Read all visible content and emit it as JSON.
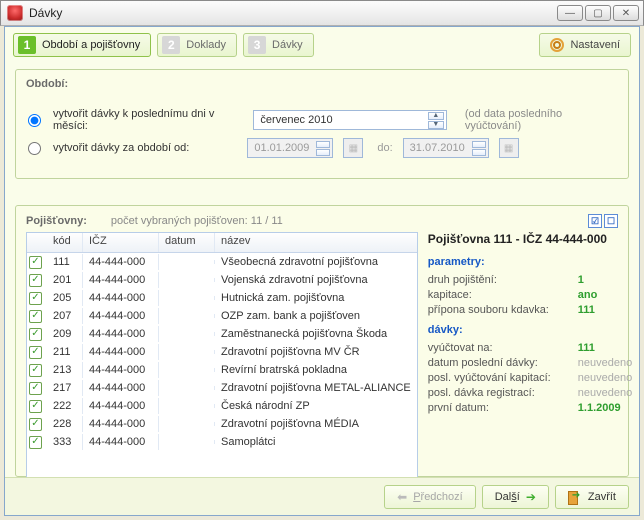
{
  "window": {
    "title": "Dávky"
  },
  "steps": [
    {
      "num": "1",
      "label": "Období a pojišťovny",
      "active": true
    },
    {
      "num": "2",
      "label": "Doklady",
      "active": false
    },
    {
      "num": "3",
      "label": "Dávky",
      "active": false
    }
  ],
  "settings_label": "Nastavení",
  "period": {
    "legend": "Období:",
    "opt_month_label": "vytvořit dávky k poslednímu dni v měsíci:",
    "opt_range_label": "vytvořit dávky za období od:",
    "month_value": "červenec 2010",
    "hint": "(od data posledního vyúčtování)",
    "date_from": "01.01.2009",
    "date_to_label": "do:",
    "date_to": "31.07.2010",
    "selected": "month"
  },
  "insurers": {
    "legend": "Pojišťovny:",
    "count_label": "počet vybraných pojišťoven: 11 / 11",
    "columns": {
      "kod": "kód",
      "icz": "IČZ",
      "datum": "datum",
      "nazev": "název"
    },
    "rows": [
      {
        "checked": true,
        "kod": "111",
        "icz": "44-444-000",
        "datum": "",
        "nazev": "Všeobecná zdravotní pojišťovna"
      },
      {
        "checked": true,
        "kod": "201",
        "icz": "44-444-000",
        "datum": "",
        "nazev": "Vojenská zdravotní pojišťovna"
      },
      {
        "checked": true,
        "kod": "205",
        "icz": "44-444-000",
        "datum": "",
        "nazev": "Hutnická zam. pojišťovna"
      },
      {
        "checked": true,
        "kod": "207",
        "icz": "44-444-000",
        "datum": "",
        "nazev": "OZP zam. bank a pojišťoven"
      },
      {
        "checked": true,
        "kod": "209",
        "icz": "44-444-000",
        "datum": "",
        "nazev": "Zaměstnanecká pojišťovna Škoda"
      },
      {
        "checked": true,
        "kod": "211",
        "icz": "44-444-000",
        "datum": "",
        "nazev": "Zdravotní pojišťovna MV ČR"
      },
      {
        "checked": true,
        "kod": "213",
        "icz": "44-444-000",
        "datum": "",
        "nazev": "Revírní bratrská pokladna"
      },
      {
        "checked": true,
        "kod": "217",
        "icz": "44-444-000",
        "datum": "",
        "nazev": "Zdravotní pojišťovna METAL-ALIANCE"
      },
      {
        "checked": true,
        "kod": "222",
        "icz": "44-444-000",
        "datum": "",
        "nazev": "Česká národní ZP"
      },
      {
        "checked": true,
        "kod": "228",
        "icz": "44-444-000",
        "datum": "",
        "nazev": "Zdravotní pojišťovna MÉDIA"
      },
      {
        "checked": true,
        "kod": "333",
        "icz": "44-444-000",
        "datum": "",
        "nazev": "Samoplátci"
      }
    ]
  },
  "detail": {
    "title": "Pojišťovna 111 - IČZ 44-444-000",
    "section_params": "parametry:",
    "druh_label": "druh pojištění:",
    "druh_value": "1",
    "kapitace_label": "kapitace:",
    "kapitace_value": "ano",
    "pripona_label": "přípona souboru kdavka:",
    "pripona_value": "111",
    "section_davky": "dávky:",
    "vyuctovat_label": "vyúčtovat na:",
    "vyuctovat_value": "111",
    "posledni_davka_label": "datum poslední dávky:",
    "posledni_davka_value": "neuvedeno",
    "posl_kapitaci_label": "posl. vyúčtování kapitací:",
    "posl_kapitaci_value": "neuvedeno",
    "posl_registraci_label": "posl. dávka registrací:",
    "posl_registraci_value": "neuvedeno",
    "prvni_datum_label": "první datum:",
    "prvni_datum_value": "1.1.2009"
  },
  "footer": {
    "prev": "Předchozí",
    "next": "Další",
    "close": "Zavřít"
  }
}
